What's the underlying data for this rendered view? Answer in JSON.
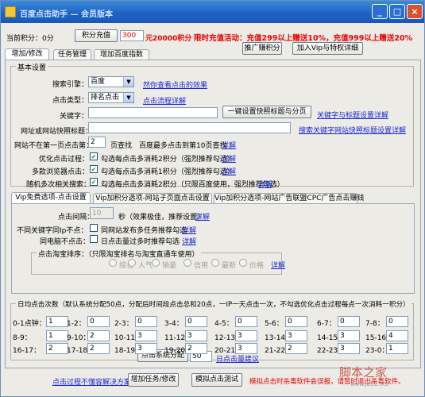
{
  "window": {
    "title": "百度点击助手 — 会员版本"
  },
  "header": {
    "points_label": "当前积分：0分",
    "recharge_button": "积分充值",
    "recharge_amount": "300",
    "recharge_result": "元20000积分",
    "promo": "限时充值活动：充值299以上赠送10%，充值999以上赠送20%",
    "referral_button": "推广赚积分",
    "vip_button": "加入Vip与特权详细"
  },
  "main_tabs": [
    "增加/修改",
    "任务管理",
    "增加百度指数"
  ],
  "basic": {
    "title": "基本设置",
    "engine_label": "搜索引擎：",
    "engine_value": "百度",
    "engine_link": "然你查看点击的效果",
    "type_label": "点击类型：",
    "type_value": "排名点击",
    "type_link": "点击流程详解",
    "keyword_label": "关键字：",
    "keyword_value": "",
    "keyword_button": "一键设置快照标题与分页",
    "keyword_link": "关键字与标题设置详解",
    "urltitle_label": "网址或网站快照标题：",
    "urltitle_value": "",
    "urltitle_link": "搜索关键字网站快照标题设置详解",
    "page_label": "网站不在第一页点击第：",
    "page_value": "2",
    "page_unit": "页查找",
    "page_note": "百度最多点击到第10页查找",
    "page_link": "详解",
    "opt_label": "优化点击过程：",
    "opt_text": "勾选每点击多消耗2积分（强烈推荐勾选）",
    "opt_link": "详解",
    "multi_label": "多款浏览器点击：",
    "multi_text": "勾选每点击多消耗1积分（强烈推荐勾选）",
    "multi_link": "详解",
    "random_label": "随机多次相关搜索：",
    "random_text": "勾选每点击多消耗2积分（只限百度使用，强烈推荐勾选）",
    "random_link": "详解"
  },
  "sub_tabs": [
    "Vip免费选项-点击设置",
    "Vip加积分选项-网站子页面点击设置",
    "Vip加积分选项-网站广告联盟CPC广告点击赚钱"
  ],
  "vip": {
    "interval_label": "点击间隔：",
    "interval_value": "10",
    "interval_unit": "秒（效果极佳，推荐设置）",
    "interval_link": "详解",
    "ip_label": "不同关键字同Ip不点：",
    "ip_text": "同网站发布多任务推荐勾选",
    "ip_link": "详解",
    "pc_label": "同电脑不点击：",
    "pc_text": "日点击量过多时推荐勾选",
    "pc_link": "详解",
    "taobao_title": "点击淘宝排序：（只限淘宝排名与淘宝直通车使用）",
    "taobao_options": [
      "综合",
      "人气",
      "销量",
      "信用",
      "最新",
      "价格"
    ],
    "taobao_link": "详解"
  },
  "daily": {
    "title": "日均点击次数（默认系统分配50点，分配后时间段点击总和20点，一IP一天点击一次，不勾选优化点击过程每点一次消耗一积分）",
    "slots": [
      {
        "label": "0-1点钟：",
        "value": "1"
      },
      {
        "label": "1-2：",
        "value": "0"
      },
      {
        "label": "2-3：",
        "value": "0"
      },
      {
        "label": "3-4：",
        "value": "0"
      },
      {
        "label": "4-5：",
        "value": "0"
      },
      {
        "label": "5-6：",
        "value": "0"
      },
      {
        "label": "6-7：",
        "value": "0"
      },
      {
        "label": "7-8：",
        "value": "0"
      },
      {
        "label": "8-9：",
        "value": "1"
      },
      {
        "label": "9-10：",
        "value": "2"
      },
      {
        "label": "10-11：",
        "value": "3"
      },
      {
        "label": "11-12：",
        "value": "3"
      },
      {
        "label": "12-13：",
        "value": "3"
      },
      {
        "label": "13-14：",
        "value": "3"
      },
      {
        "label": "14-15：",
        "value": "3"
      },
      {
        "label": "15-16：",
        "value": "4"
      },
      {
        "label": "16-17：",
        "value": "2"
      },
      {
        "label": "17-18：",
        "value": "2"
      },
      {
        "label": "18-19：",
        "value": "3"
      },
      {
        "label": "19-20：",
        "value": "2"
      },
      {
        "label": "20-21：",
        "value": "3"
      },
      {
        "label": "21-22：",
        "value": "2"
      },
      {
        "label": "22-23：",
        "value": "3"
      },
      {
        "label": "23-0：",
        "value": "1"
      }
    ],
    "assign_button": "点击系统分配",
    "assign_value": "50",
    "assign_link": "日点击量建议"
  },
  "footer": {
    "link": "点击过程不懂容解决方案",
    "add_button": "增加任务/修改",
    "sim_button": "模拟点击测试",
    "note": "模拟点击时杀毒软件会误报，请暂时退出杀毒软件。"
  },
  "watermark": {
    "text": "脚本之家",
    "sub": "www.jb51.net"
  }
}
